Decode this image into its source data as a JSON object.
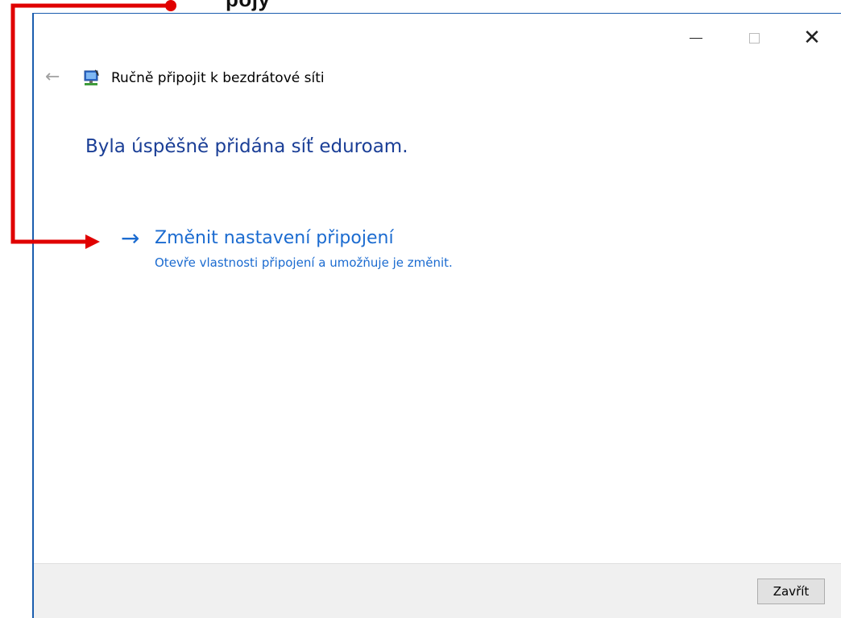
{
  "annotation": {
    "top_caption": "pojy",
    "arrow_color": "#e00000"
  },
  "window": {
    "title": "Ručně připojit k bezdrátové síti",
    "controls": {
      "minimize": "—",
      "maximize": "□",
      "close": "✕"
    }
  },
  "content": {
    "heading": "Byla úspěšně přidána síť eduroam.",
    "option": {
      "arrow": "→",
      "label": "Změnit nastavení připojení",
      "description": "Otevře vlastnosti připojení a umožňuje je změnit."
    }
  },
  "footer": {
    "close_label": "Zavřít"
  },
  "icons": {
    "back": "back-arrow-icon",
    "network": "network-icon"
  }
}
